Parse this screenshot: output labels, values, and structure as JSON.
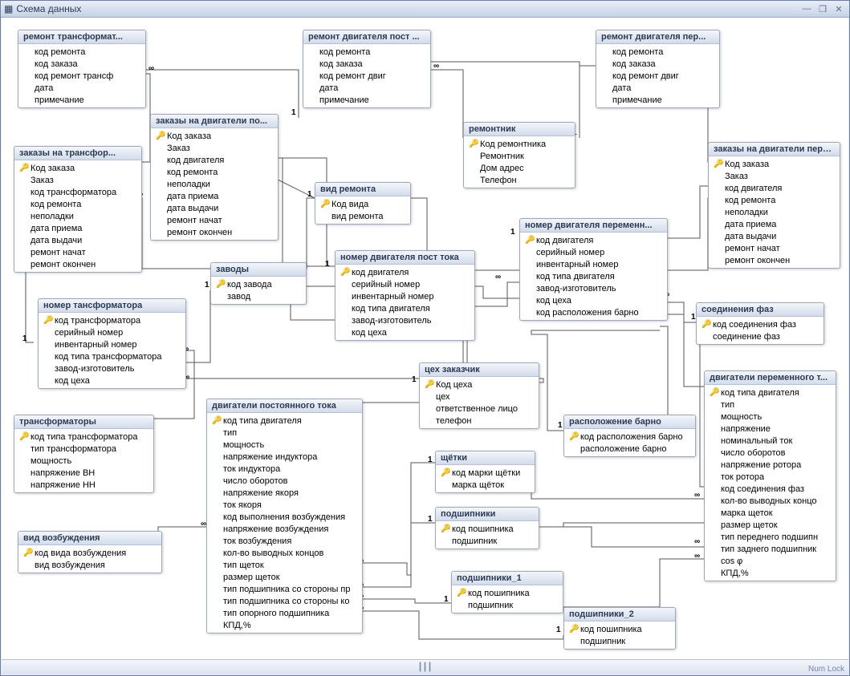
{
  "window": {
    "title": "Схема данных"
  },
  "status": "Num Lock",
  "rel_one": "1",
  "rel_many": "∞",
  "tables": {
    "remont_transf": {
      "title": "ремонт трансформат...",
      "fields": [
        {
          "k": false,
          "n": "код ремонта"
        },
        {
          "k": false,
          "n": "код заказа"
        },
        {
          "k": false,
          "n": "код ремонт трансф"
        },
        {
          "k": false,
          "n": "дата"
        },
        {
          "k": false,
          "n": "примечание"
        }
      ]
    },
    "remont_dvig_post": {
      "title": "ремонт двигателя пост ...",
      "fields": [
        {
          "k": false,
          "n": "код ремонта"
        },
        {
          "k": false,
          "n": "код заказа"
        },
        {
          "k": false,
          "n": "код ремонт двиг"
        },
        {
          "k": false,
          "n": "дата"
        },
        {
          "k": false,
          "n": "примечание"
        }
      ]
    },
    "remont_dvig_per": {
      "title": "ремонт двигателя пер...",
      "fields": [
        {
          "k": false,
          "n": "код ремонта"
        },
        {
          "k": false,
          "n": "код заказа"
        },
        {
          "k": false,
          "n": "код ремонт двиг"
        },
        {
          "k": false,
          "n": "дата"
        },
        {
          "k": false,
          "n": "примечание"
        }
      ]
    },
    "zakazy_transf": {
      "title": "заказы на трансфор...",
      "fields": [
        {
          "k": true,
          "n": "Код заказа"
        },
        {
          "k": false,
          "n": "Заказ"
        },
        {
          "k": false,
          "n": "код трансформатора"
        },
        {
          "k": false,
          "n": "код ремонта"
        },
        {
          "k": false,
          "n": "неполадки"
        },
        {
          "k": false,
          "n": "дата приема"
        },
        {
          "k": false,
          "n": "дата выдачи"
        },
        {
          "k": false,
          "n": "ремонт начат"
        },
        {
          "k": false,
          "n": "ремонт окончен"
        }
      ]
    },
    "zakazy_dvig_post": {
      "title": "заказы на двигатели по...",
      "fields": [
        {
          "k": true,
          "n": "Код заказа"
        },
        {
          "k": false,
          "n": "Заказ"
        },
        {
          "k": false,
          "n": "код двигателя"
        },
        {
          "k": false,
          "n": "код ремонта"
        },
        {
          "k": false,
          "n": "неполадки"
        },
        {
          "k": false,
          "n": "дата приема"
        },
        {
          "k": false,
          "n": "дата выдачи"
        },
        {
          "k": false,
          "n": "ремонт начат"
        },
        {
          "k": false,
          "n": "ремонт окончен"
        }
      ]
    },
    "zakazy_dvig_per": {
      "title": "заказы на двигатели пере...",
      "fields": [
        {
          "k": true,
          "n": "Код заказа"
        },
        {
          "k": false,
          "n": "Заказ"
        },
        {
          "k": false,
          "n": "код двигателя"
        },
        {
          "k": false,
          "n": "код ремонта"
        },
        {
          "k": false,
          "n": "неполадки"
        },
        {
          "k": false,
          "n": "дата приема"
        },
        {
          "k": false,
          "n": "дата выдачи"
        },
        {
          "k": false,
          "n": "ремонт начат"
        },
        {
          "k": false,
          "n": "ремонт окончен"
        }
      ]
    },
    "remontnik": {
      "title": "ремонтник",
      "fields": [
        {
          "k": true,
          "n": "Код ремонтника"
        },
        {
          "k": false,
          "n": "Ремонтник"
        },
        {
          "k": false,
          "n": "Дом адрес"
        },
        {
          "k": false,
          "n": "Телефон"
        }
      ]
    },
    "vid_remonta": {
      "title": "вид ремонта",
      "fields": [
        {
          "k": true,
          "n": "Код вида"
        },
        {
          "k": false,
          "n": "вид ремонта"
        }
      ]
    },
    "zavody": {
      "title": "заводы",
      "fields": [
        {
          "k": true,
          "n": "код завода"
        },
        {
          "k": false,
          "n": "завод"
        }
      ]
    },
    "nomer_transf": {
      "title": "номер тансформатора",
      "fields": [
        {
          "k": true,
          "n": "код трансформатора"
        },
        {
          "k": false,
          "n": "серийный номер"
        },
        {
          "k": false,
          "n": "инвентарный номер"
        },
        {
          "k": false,
          "n": "код типа трансформатора"
        },
        {
          "k": false,
          "n": "завод-изготовитель"
        },
        {
          "k": false,
          "n": "код цеха"
        }
      ]
    },
    "nomer_dvig_post": {
      "title": "номер двигателя пост тока",
      "fields": [
        {
          "k": true,
          "n": "код двигателя"
        },
        {
          "k": false,
          "n": "серийный номер"
        },
        {
          "k": false,
          "n": "инвентарный номер"
        },
        {
          "k": false,
          "n": "код типа двигателя"
        },
        {
          "k": false,
          "n": "завод-изготовитель"
        },
        {
          "k": false,
          "n": "код цеха"
        }
      ]
    },
    "nomer_dvig_per": {
      "title": "номер двигателя переменн...",
      "fields": [
        {
          "k": true,
          "n": "код двигателя"
        },
        {
          "k": false,
          "n": "серийный номер"
        },
        {
          "k": false,
          "n": "инвентарный номер"
        },
        {
          "k": false,
          "n": "код типа двигателя"
        },
        {
          "k": false,
          "n": "завод-изготовитель"
        },
        {
          "k": false,
          "n": "код цеха"
        },
        {
          "k": false,
          "n": "код расположения барно"
        }
      ]
    },
    "tseh": {
      "title": "цех заказчик",
      "fields": [
        {
          "k": true,
          "n": "Код цеха"
        },
        {
          "k": false,
          "n": "цех"
        },
        {
          "k": false,
          "n": "ответственное лицо"
        },
        {
          "k": false,
          "n": "телефон"
        }
      ]
    },
    "soed_faz": {
      "title": "соединения фаз",
      "fields": [
        {
          "k": true,
          "n": "код соединения фаз"
        },
        {
          "k": false,
          "n": "соединение фаз"
        }
      ]
    },
    "raspol_barno": {
      "title": "расположение барно",
      "fields": [
        {
          "k": true,
          "n": "код расположения барно"
        },
        {
          "k": false,
          "n": "расположение барно"
        }
      ]
    },
    "transformatory": {
      "title": "трансформаторы",
      "fields": [
        {
          "k": true,
          "n": "код типа трансформатора"
        },
        {
          "k": false,
          "n": "тип трансформатора"
        },
        {
          "k": false,
          "n": "мощность"
        },
        {
          "k": false,
          "n": "напряжение ВН"
        },
        {
          "k": false,
          "n": "напряжение НН"
        }
      ]
    },
    "vid_vozb": {
      "title": "вид возбуждения",
      "fields": [
        {
          "k": true,
          "n": "код вида возбуждения"
        },
        {
          "k": false,
          "n": "вид возбуждения"
        }
      ]
    },
    "dvig_post": {
      "title": "двигатели постоянного тока",
      "fields": [
        {
          "k": true,
          "n": "код типа двигателя"
        },
        {
          "k": false,
          "n": "тип"
        },
        {
          "k": false,
          "n": "мощность"
        },
        {
          "k": false,
          "n": "напряжение индуктора"
        },
        {
          "k": false,
          "n": "ток индуктора"
        },
        {
          "k": false,
          "n": "число оборотов"
        },
        {
          "k": false,
          "n": "напряжение якоря"
        },
        {
          "k": false,
          "n": "ток якоря"
        },
        {
          "k": false,
          "n": "код выполнения возбуждения"
        },
        {
          "k": false,
          "n": "напряжение возбуждения"
        },
        {
          "k": false,
          "n": "ток возбуждения"
        },
        {
          "k": false,
          "n": "кол-во выводных концов"
        },
        {
          "k": false,
          "n": "тип щеток"
        },
        {
          "k": false,
          "n": "размер щеток"
        },
        {
          "k": false,
          "n": "тип подшипника со стороны пр"
        },
        {
          "k": false,
          "n": "тип подшипника со стороны ко"
        },
        {
          "k": false,
          "n": "тип опорного подшипника"
        },
        {
          "k": false,
          "n": "КПД,%"
        }
      ]
    },
    "dvig_per": {
      "title": "двигатели переменного т...",
      "fields": [
        {
          "k": true,
          "n": "код типа двигателя"
        },
        {
          "k": false,
          "n": "тип"
        },
        {
          "k": false,
          "n": "мощность"
        },
        {
          "k": false,
          "n": "напряжение"
        },
        {
          "k": false,
          "n": "номинальный  ток"
        },
        {
          "k": false,
          "n": "число оборотов"
        },
        {
          "k": false,
          "n": "напряжение ротора"
        },
        {
          "k": false,
          "n": "ток ротора"
        },
        {
          "k": false,
          "n": "код соединения фаз"
        },
        {
          "k": false,
          "n": "кол-во выводных концо"
        },
        {
          "k": false,
          "n": "марка щеток"
        },
        {
          "k": false,
          "n": "размер щеток"
        },
        {
          "k": false,
          "n": "тип переднего подшипн"
        },
        {
          "k": false,
          "n": "тип заднего подшипник"
        },
        {
          "k": false,
          "n": "cos φ"
        },
        {
          "k": false,
          "n": "КПД,%"
        }
      ]
    },
    "shchetki": {
      "title": "щётки",
      "fields": [
        {
          "k": true,
          "n": "код марки щётки"
        },
        {
          "k": false,
          "n": "марка щёток"
        }
      ]
    },
    "podship": {
      "title": "подшипники",
      "fields": [
        {
          "k": true,
          "n": "код пошипника"
        },
        {
          "k": false,
          "n": "подшипник"
        }
      ]
    },
    "podship1": {
      "title": "подшипники_1",
      "fields": [
        {
          "k": true,
          "n": "код пошипника"
        },
        {
          "k": false,
          "n": "подшипник"
        }
      ]
    },
    "podship2": {
      "title": "подшипники_2",
      "fields": [
        {
          "k": true,
          "n": "код пошипника"
        },
        {
          "k": false,
          "n": "подшипник"
        }
      ]
    }
  }
}
